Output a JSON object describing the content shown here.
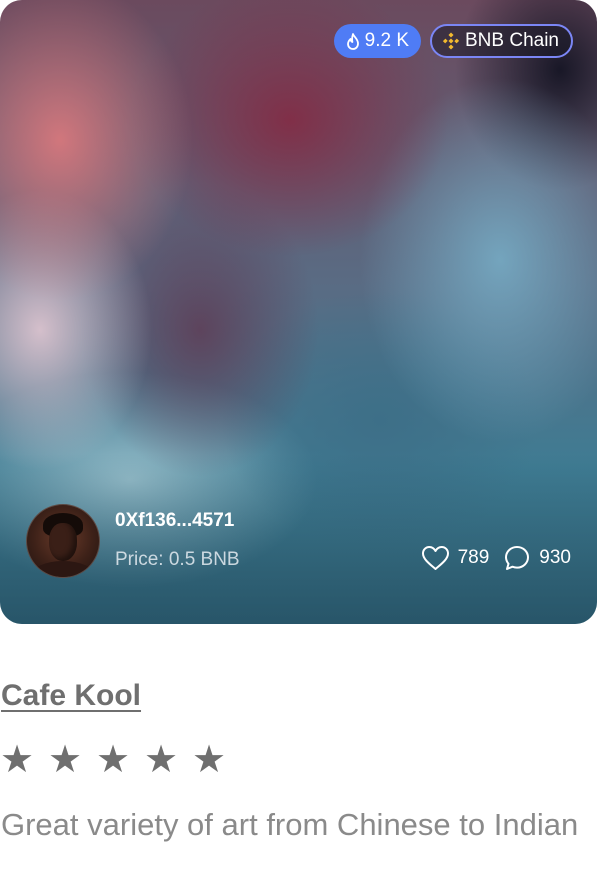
{
  "card": {
    "likes_badge": "9.2 K",
    "chain_badge": "BNB Chain",
    "owner_address": "0Xf136...4571",
    "price": "Price: 0.5 BNB",
    "like_count": "789",
    "comment_count": "930",
    "title": "Cafe Kool",
    "rating": {
      "value": 5,
      "max": 5
    },
    "description": "Great variety of art from Chinese to Indian"
  },
  "icons": {
    "likes_badge": "flame-icon",
    "chain_badge": "bnb-logo-icon",
    "likes": "heart-icon",
    "comments": "comment-bubble-icon",
    "rating": "star-icon"
  },
  "colors": {
    "likes_badge_bg": "#4f7cf5",
    "chain_badge_border": "#7b86f5",
    "bnb_gold": "#f3ba2f",
    "title_text": "#6f6f6f",
    "description_text": "#8a8a8a"
  }
}
